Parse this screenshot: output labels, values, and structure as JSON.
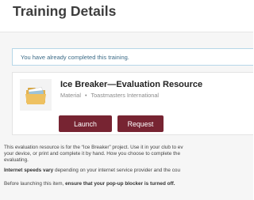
{
  "page": {
    "title": "Training Details"
  },
  "notice": {
    "text": "You have already completed this training."
  },
  "resource": {
    "title": "Ice Breaker—Evaluation Resource",
    "type": "Material",
    "separator": "•",
    "publisher": "Toastmasters International",
    "icon": "folder-icon"
  },
  "actions": {
    "launch_label": "Launch",
    "request_label": "Request"
  },
  "description": {
    "line1": "This evaluation resource is for the “Ice Breaker” project. Use it in your club to ev",
    "line2": "your device, or print and complete it by hand. How you choose to complete the",
    "line3": "evaluating."
  },
  "speed_note": {
    "bold": "Internet speeds vary",
    "rest": " depending on your internet service provider and the cou"
  },
  "popup_note": {
    "lead": "Before launching this item, ",
    "bold": "ensure that your pop-up blocker is turned off."
  },
  "colors": {
    "brand": "#772432",
    "notice_border": "#b6d7e8",
    "notice_text": "#3c6b87"
  }
}
